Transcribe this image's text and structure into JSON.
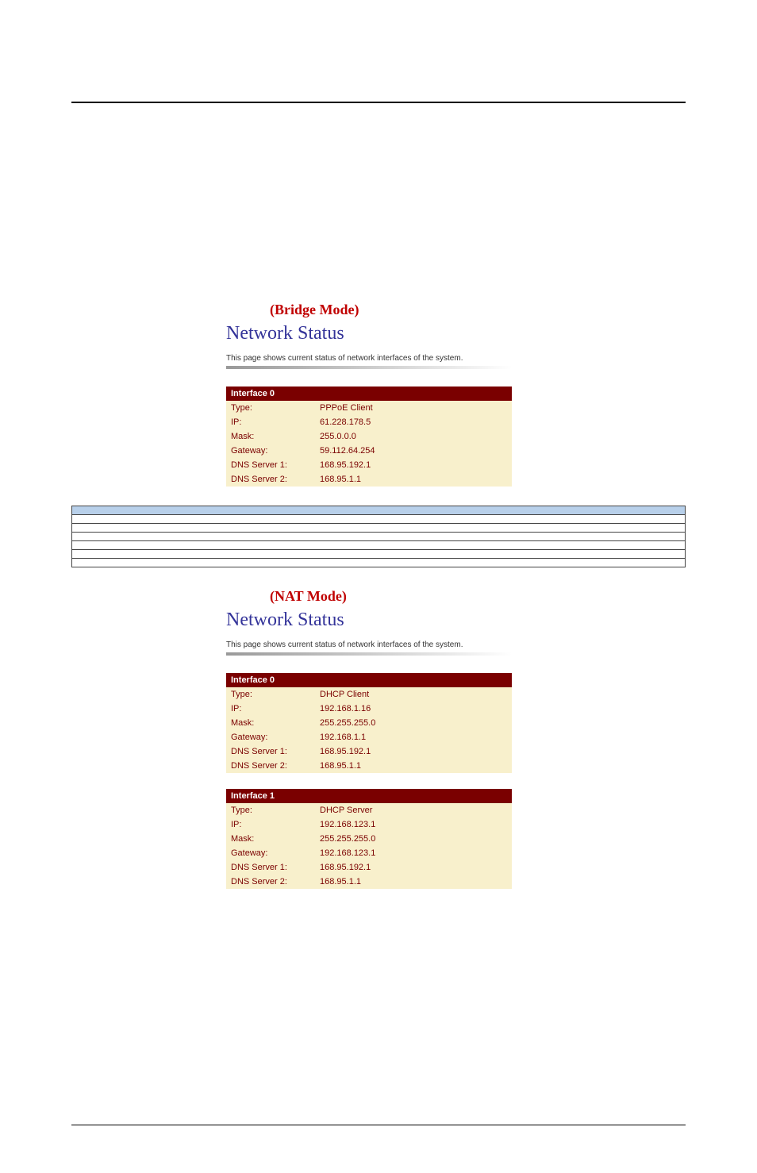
{
  "bridge": {
    "mode_label": "(Bridge Mode)",
    "title": "Network Status",
    "description": "This page shows current status of network interfaces of the system.",
    "interfaces": [
      {
        "header": "Interface 0",
        "rows": [
          {
            "label": "Type:",
            "value": "PPPoE Client"
          },
          {
            "label": "IP:",
            "value": "61.228.178.5"
          },
          {
            "label": "Mask:",
            "value": "255.0.0.0"
          },
          {
            "label": "Gateway:",
            "value": "59.112.64.254"
          },
          {
            "label": "DNS Server 1:",
            "value": "168.95.192.1"
          },
          {
            "label": "DNS Server 2:",
            "value": "168.95.1.1"
          }
        ]
      }
    ]
  },
  "description_table": {
    "header_field": "",
    "header_desc": "",
    "rows": [
      {
        "field": "",
        "desc": ""
      },
      {
        "field": "",
        "desc": ""
      },
      {
        "field": "",
        "desc": ""
      },
      {
        "field": "",
        "desc": ""
      },
      {
        "field": "",
        "desc": ""
      },
      {
        "field": "",
        "desc": ""
      }
    ]
  },
  "nat": {
    "mode_label": "(NAT Mode)",
    "title": "Network Status",
    "description": "This page shows current status of network interfaces of the system.",
    "interfaces": [
      {
        "header": "Interface 0",
        "rows": [
          {
            "label": "Type:",
            "value": "DHCP Client"
          },
          {
            "label": "IP:",
            "value": "192.168.1.16"
          },
          {
            "label": "Mask:",
            "value": "255.255.255.0"
          },
          {
            "label": "Gateway:",
            "value": "192.168.1.1"
          },
          {
            "label": "DNS Server 1:",
            "value": "168.95.192.1"
          },
          {
            "label": "DNS Server 2:",
            "value": "168.95.1.1"
          }
        ]
      },
      {
        "header": "Interface 1",
        "rows": [
          {
            "label": "Type:",
            "value": "DHCP Server"
          },
          {
            "label": "IP:",
            "value": "192.168.123.1"
          },
          {
            "label": "Mask:",
            "value": "255.255.255.0"
          },
          {
            "label": "Gateway:",
            "value": "192.168.123.1"
          },
          {
            "label": "DNS Server 1:",
            "value": "168.95.192.1"
          },
          {
            "label": "DNS Server 2:",
            "value": "168.95.1.1"
          }
        ]
      }
    ]
  }
}
